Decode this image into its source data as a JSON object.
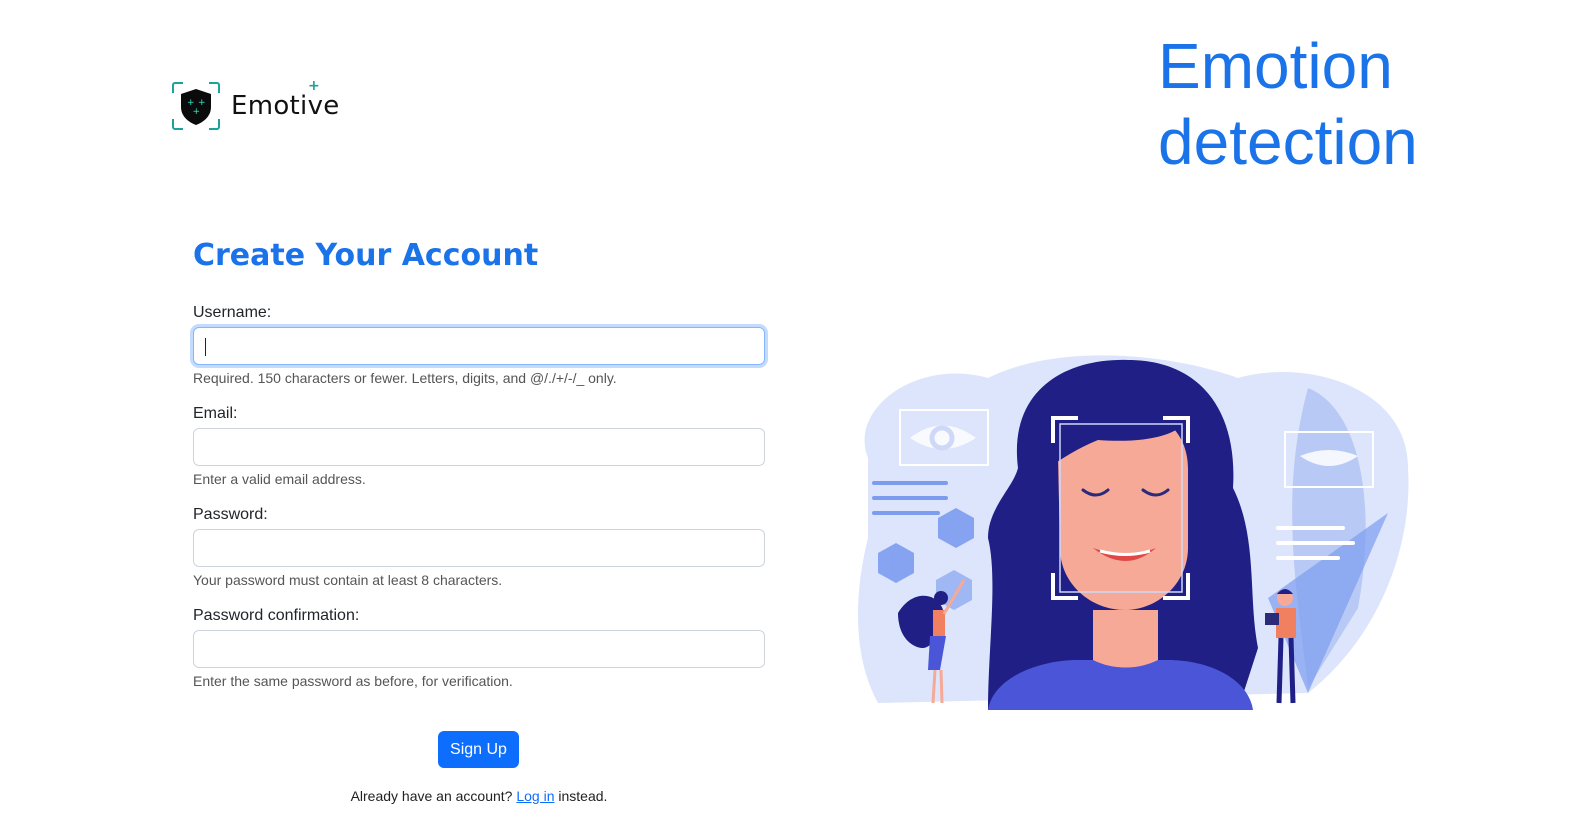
{
  "brand": {
    "name": "Emotive",
    "logo_icon": "shield-face-scan-icon"
  },
  "hero": {
    "title_line1": "Emotion",
    "title_line2": "detection"
  },
  "form": {
    "title": "Create Your Account",
    "fields": [
      {
        "label": "Username:",
        "value": "",
        "help": "Required. 150 characters or fewer. Letters, digits, and @/./+/-/_ only."
      },
      {
        "label": "Email:",
        "value": "",
        "help": "Enter a valid email address."
      },
      {
        "label": "Password:",
        "value": "",
        "help": "Your password must contain at least 8 characters."
      },
      {
        "label": "Password confirmation:",
        "value": "",
        "help": "Enter the same password as before, for verification."
      }
    ],
    "submit_label": "Sign Up",
    "login_prefix": "Already have an account?",
    "login_link": "Log in",
    "login_suffix": "instead."
  },
  "colors": {
    "accent": "#1a73e8",
    "button": "#0d6efd",
    "brand_teal": "#1aa39a"
  },
  "illustration": {
    "icon": "face-recognition-illustration"
  }
}
